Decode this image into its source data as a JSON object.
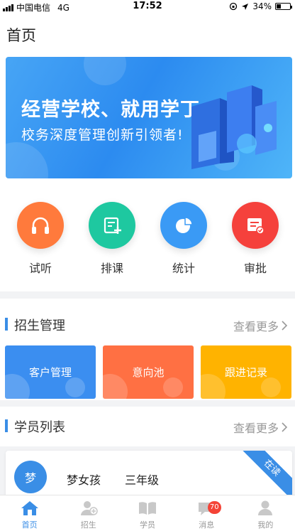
{
  "status_bar": {
    "carrier": "中国电信",
    "network": "4G",
    "time": "17:52",
    "battery": "34%",
    "battery_level": 0.34
  },
  "header": {
    "title": "首页"
  },
  "banner": {
    "title": "经营学校、就用学丁",
    "subtitle": "校务深度管理创新引领者!"
  },
  "quick_actions": [
    {
      "label": "试听",
      "icon": "headphones-icon",
      "color": "#ff7a3c"
    },
    {
      "label": "排课",
      "icon": "schedule-add-icon",
      "color": "#1ec8a0"
    },
    {
      "label": "统计",
      "icon": "pie-chart-icon",
      "color": "#3a9af5"
    },
    {
      "label": "审批",
      "icon": "approval-icon",
      "color": "#f5413c"
    }
  ],
  "enrollment": {
    "title": "招生管理",
    "more": "查看更多",
    "tiles": [
      {
        "label": "客户管理",
        "color": "#3b8ef0"
      },
      {
        "label": "意向池",
        "color": "#ff7043"
      },
      {
        "label": "跟进记录",
        "color": "#ffb300"
      }
    ]
  },
  "students": {
    "title": "学员列表",
    "more": "查看更多",
    "first": {
      "avatar": "梦",
      "name": "梦女孩",
      "grade": "三年级",
      "status": "在读"
    }
  },
  "tab_bar": {
    "items": [
      {
        "label": "首页",
        "icon": "home-icon",
        "active": true
      },
      {
        "label": "招生",
        "icon": "add-user-icon",
        "active": false
      },
      {
        "label": "学员",
        "icon": "book-icon",
        "active": false
      },
      {
        "label": "消息",
        "icon": "message-icon",
        "active": false,
        "badge": "70"
      },
      {
        "label": "我的",
        "icon": "profile-icon",
        "active": false
      }
    ]
  },
  "colors": {
    "accent": "#3a8ee6"
  }
}
